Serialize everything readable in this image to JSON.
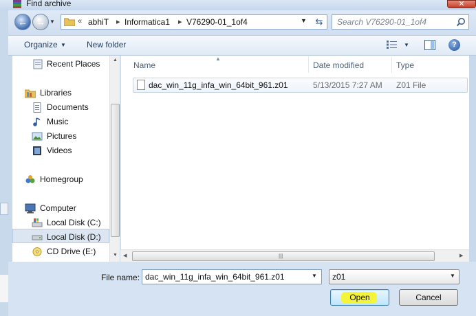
{
  "window": {
    "title": "Find archive",
    "close_glyph": "✕"
  },
  "nav": {
    "back_icon": "back-arrow-icon",
    "forward_icon": "forward-arrow-icon",
    "breadcrumb_overflow": "«",
    "breadcrumbs": [
      "abhiT",
      "Informatica1",
      "V76290-01_1of4"
    ],
    "search_placeholder": "Search V76290-01_1of4"
  },
  "toolbar": {
    "organize": "Organize",
    "new_folder": "New folder"
  },
  "navpane": {
    "items": [
      {
        "label": "Recent Places",
        "icon": "recent-places-icon",
        "indent": false
      },
      {
        "label": "Libraries",
        "icon": "libraries-icon",
        "indent": false
      },
      {
        "label": "Documents",
        "icon": "documents-icon",
        "indent": true
      },
      {
        "label": "Music",
        "icon": "music-icon",
        "indent": true
      },
      {
        "label": "Pictures",
        "icon": "pictures-icon",
        "indent": true
      },
      {
        "label": "Videos",
        "icon": "videos-icon",
        "indent": true
      },
      {
        "label": "Homegroup",
        "icon": "homegroup-icon",
        "indent": false
      },
      {
        "label": "Computer",
        "icon": "computer-icon",
        "indent": false
      },
      {
        "label": "Local Disk (C:)",
        "icon": "local-disk-c-icon",
        "indent": true
      },
      {
        "label": "Local Disk (D:)",
        "icon": "local-disk-d-icon",
        "indent": true,
        "selected": true
      },
      {
        "label": "CD Drive (E:)",
        "icon": "cd-drive-icon",
        "indent": true
      }
    ]
  },
  "filelist": {
    "columns": [
      "Name",
      "Date modified",
      "Type"
    ],
    "rows": [
      {
        "name": "dac_win_11g_infa_win_64bit_961.z01",
        "date": "5/13/2015 7:27 AM",
        "type": "Z01 File"
      }
    ]
  },
  "bottom": {
    "file_name_label": "File name:",
    "file_name_value": "dac_win_11g_infa_win_64bit_961.z01",
    "file_type_value": "z01",
    "open_label": "Open",
    "cancel_label": "Cancel"
  },
  "colors": {
    "accent": "#2c5aa0",
    "highlight": "#f4f43a"
  }
}
